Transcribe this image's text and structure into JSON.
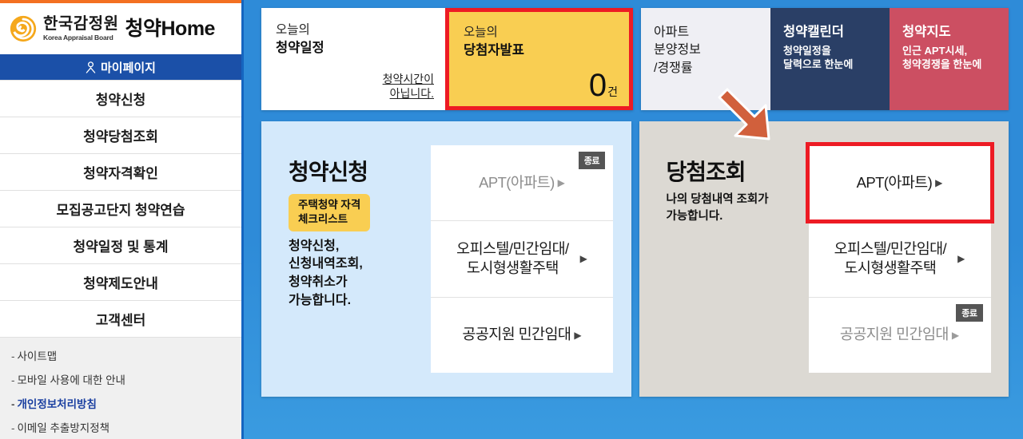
{
  "sidebar": {
    "logo": {
      "org_ko": "한국감정원",
      "org_en": "Korea Appraisal Board",
      "brand": "청약Home",
      "spiral_icon": "spiral-logo-icon"
    },
    "mypage": {
      "label": "마이페이지",
      "icon": "person-icon"
    },
    "nav_items": [
      {
        "label": "청약신청"
      },
      {
        "label": "청약당첨조회"
      },
      {
        "label": "청약자격확인"
      },
      {
        "label": "모집공고단지 청약연습"
      },
      {
        "label": "청약일정 및 통계"
      },
      {
        "label": "청약제도안내"
      },
      {
        "label": "고객센터"
      }
    ],
    "footer_links": [
      {
        "label": "사이트맵",
        "accent": false
      },
      {
        "label": "모바일 사용에 대한 안내",
        "accent": false
      },
      {
        "label": "개인정보처리방침",
        "accent": true
      },
      {
        "label": "이메일 추출방지정책",
        "accent": false
      }
    ],
    "dash": "-"
  },
  "top_cards": {
    "schedule": {
      "line1": "오늘의",
      "line2": "청약일정",
      "note_line1": "청약시간이",
      "note_line2": "아닙니다."
    },
    "winner": {
      "line1": "오늘의",
      "line2": "당첨자발표",
      "count": "0",
      "unit": "건"
    },
    "tiles": [
      {
        "title_l1": "아파트",
        "title_l2": "분양정보",
        "title_l3": "/경쟁률"
      },
      {
        "title": "청약캘린더",
        "sub_l1": "청약일정을",
        "sub_l2": "달력으로 한눈에"
      },
      {
        "title": "청약지도",
        "sub_l1": "인근 APT시세,",
        "sub_l2": "청약경쟁을 한눈에"
      }
    ]
  },
  "panels": {
    "apply": {
      "title": "청약신청",
      "badge_l1": "주택청약 자격",
      "badge_l2": "체크리스트",
      "desc_l1": "청약신청,",
      "desc_l2": "신청내역조회,",
      "desc_l3": "청약취소가",
      "desc_l4": "가능합니다.",
      "items": [
        {
          "label": "APT(아파트)",
          "badge": "종료",
          "disabled": true,
          "highlight": false
        },
        {
          "label_l1": "오피스텔/민간임대/",
          "label_l2": "도시형생활주택",
          "disabled": false,
          "highlight": false
        },
        {
          "label": "공공지원 민간임대",
          "disabled": false,
          "highlight": false
        }
      ]
    },
    "result": {
      "title": "당첨조회",
      "desc_l1": "나의 당첨내역 조회가",
      "desc_l2": "가능합니다.",
      "items": [
        {
          "label": "APT(아파트)",
          "disabled": false,
          "highlight": true
        },
        {
          "label_l1": "오피스텔/민간임대/",
          "label_l2": "도시형생활주택",
          "disabled": false,
          "highlight": false
        },
        {
          "label": "공공지원 민간임대",
          "badge": "종료",
          "disabled": true,
          "highlight": false
        }
      ]
    }
  },
  "annotations": {
    "arrow": "orange-down-right-arrow",
    "highlight_color": "#ED1B24",
    "arrow_color": "#D1603C"
  },
  "colors": {
    "brand_blue": "#1B50A8",
    "main_bg_blue": "#2E8BD8",
    "accent_yellow": "#F9CE52",
    "panel_apply_bg": "#D4E9FB",
    "panel_result_bg": "#DCD9D3",
    "tile_calendar": "#2A3F66",
    "tile_map": "#CC4F62",
    "top_orange": "#F37021"
  }
}
